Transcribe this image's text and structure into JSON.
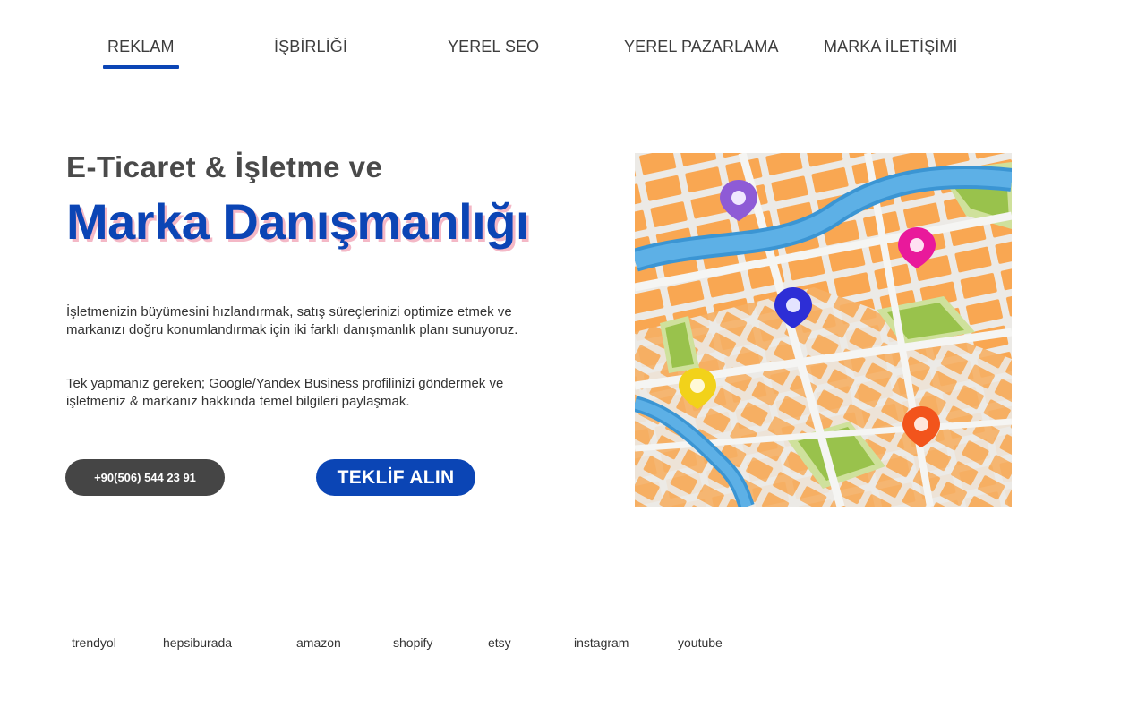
{
  "nav": {
    "tabs": [
      {
        "label": "REKLAM",
        "active": true
      },
      {
        "label": "İŞBİRLİĞİ",
        "active": false
      },
      {
        "label": "YEREL SEO",
        "active": false
      },
      {
        "label": "YEREL PAZARLAMA",
        "active": false
      },
      {
        "label": "MARKA İLETİŞİMİ",
        "active": false
      }
    ],
    "accent_color": "#0b45b5"
  },
  "hero": {
    "subtitle": "E-Ticaret & İşletme ve",
    "title": "Marka Danışmanlığı",
    "description_1": "İşletmenizin büyümesini hızlandırmak, satış süreçlerinizi optimize etmek ve markanızı doğru konumlandırmak için iki farklı danışmanlık planı sunuyoruz.",
    "description_2": "Tek yapmanız gereken; Google/Yandex Business profilinizi göndermek ve işletmeniz & markanız hakkında temel bilgileri paylaşmak.",
    "phone_button": "+90(506) 544 23 91",
    "offer_button": "TEKLİF ALIN",
    "title_color": "#0b45b5",
    "title_shadow_color": "#f4b8c6",
    "phone_button_color": "#454545"
  },
  "map": {
    "icon": "city-map-illustration",
    "pins": [
      {
        "color": "#8e5bd6",
        "icon": "location-pin-icon"
      },
      {
        "color": "#e9199b",
        "icon": "location-pin-icon"
      },
      {
        "color": "#2d2ed6",
        "icon": "location-pin-icon"
      },
      {
        "color": "#f2d21a",
        "icon": "location-pin-icon"
      },
      {
        "color": "#f2541c",
        "icon": "location-pin-icon"
      }
    ]
  },
  "footer": {
    "links": [
      "trendyol",
      "hepsiburada",
      "amazon",
      "shopify",
      "etsy",
      "instagram",
      "youtube"
    ]
  }
}
